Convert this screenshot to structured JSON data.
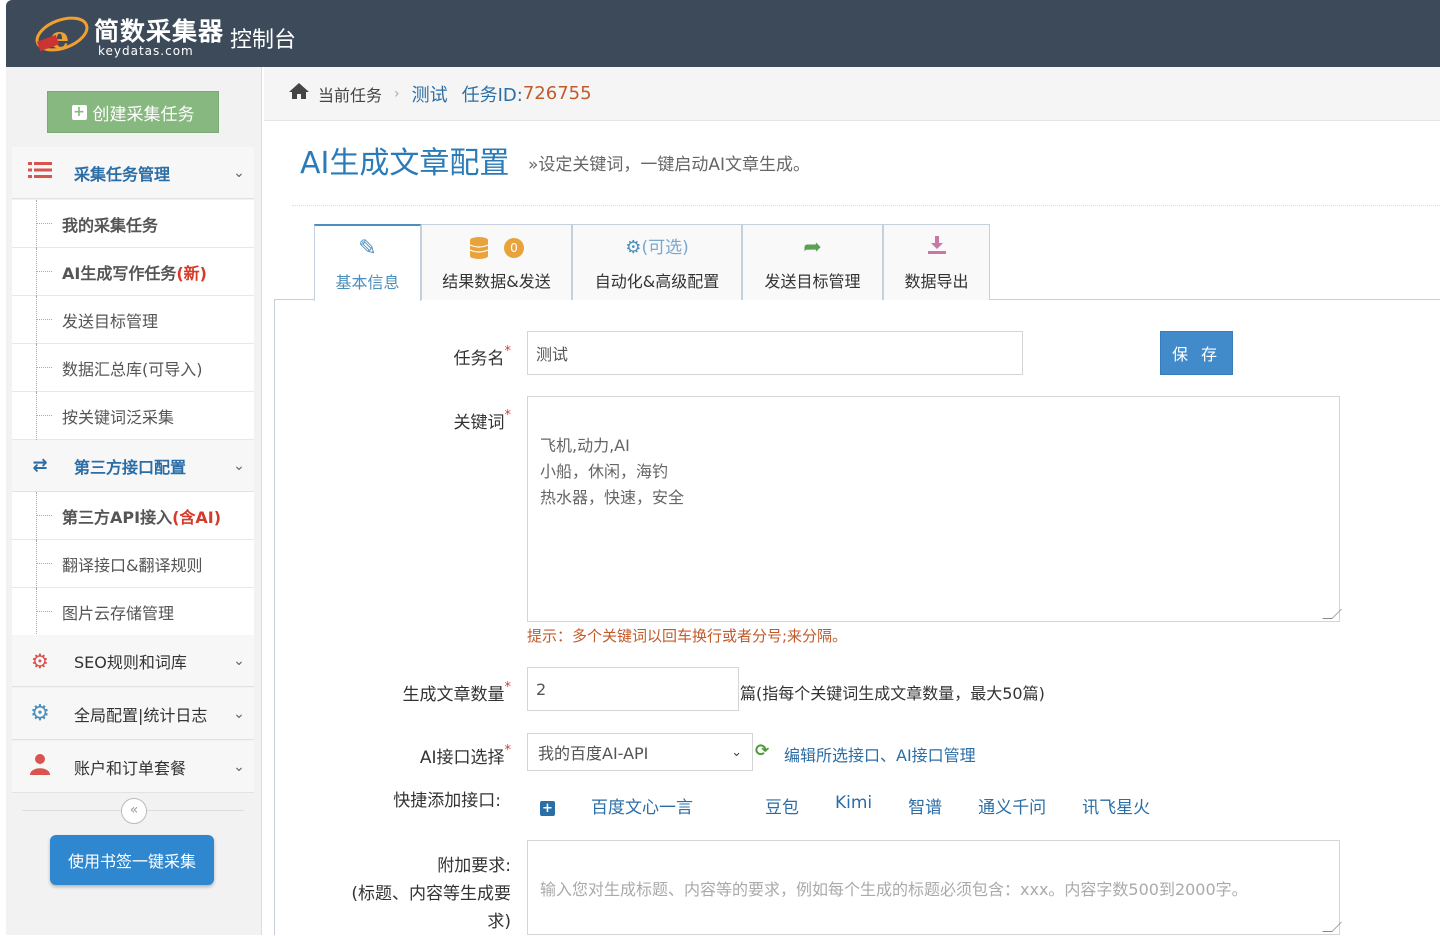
{
  "header": {
    "brand": "简数采集器",
    "brand_sub": "keydatas.com",
    "title": "控制台"
  },
  "sidebar": {
    "create_button": "创建采集任务",
    "groups": {
      "task_mgmt": "采集任务管理",
      "third_party": "第三方接口配置",
      "seo": "SEO规则和词库",
      "global": "全局配置|统计日志",
      "account": "账户和订单套餐"
    },
    "items": {
      "my_tasks": "我的采集任务",
      "ai_writing": "AI生成写作任务",
      "ai_writing_new": "(新)",
      "send_targets": "发送目标管理",
      "data_library": "数据汇总库(可导入)",
      "keyword_collect": "按关键词泛采集",
      "api_access": "第三方API接入",
      "api_access_tag": "(含AI)",
      "translate": "翻译接口&翻译规则",
      "image_cloud": "图片云存储管理"
    },
    "bookmark_button": "使用书签一键采集"
  },
  "breadcrumb": {
    "current": "当前任务",
    "task": "测试",
    "id_label": "任务ID:",
    "id": "726755"
  },
  "page": {
    "title": "AI生成文章配置",
    "subtitle": "»设定关键词，一键启动AI文章生成。"
  },
  "tabs": [
    {
      "label": "基本信息"
    },
    {
      "label": "结果数据&发送",
      "badge": "0"
    },
    {
      "label": "自动化&高级配置",
      "prefix": "(可选)"
    },
    {
      "label": "发送目标管理"
    },
    {
      "label": "数据导出"
    }
  ],
  "form": {
    "task_name_label": "任务名",
    "task_name_value": "测试",
    "save_button": "保 存",
    "keywords_label": "关键词",
    "keywords_value": "飞机,动力,AI\n小船，休闲，海钓\n热水器，快速，安全",
    "keywords_hint": "提示：多个关键词以回车换行或者分号;来分隔。",
    "count_label": "生成文章数量",
    "count_value": "2",
    "count_suffix": "篇(指每个关键词生成文章数量，最大50篇)",
    "api_label": "AI接口选择",
    "api_selected": "我的百度AI-API",
    "api_links": "编辑所选接口、AI接口管理",
    "quick_label": "快捷添加接口:",
    "quick_options": [
      "百度文心一言",
      "豆包",
      "Kimi",
      "智谱",
      "通义千问",
      "讯飞星火"
    ],
    "extra_label_1": "附加要求:",
    "extra_label_2": "(标题、内容等生成要",
    "extra_label_3": "求)",
    "extra_placeholder": "输入您对生成标题、内容等的要求，例如每个生成的标题必须包含：xxx。内容字数500到2000字。",
    "required_mark": "*"
  }
}
